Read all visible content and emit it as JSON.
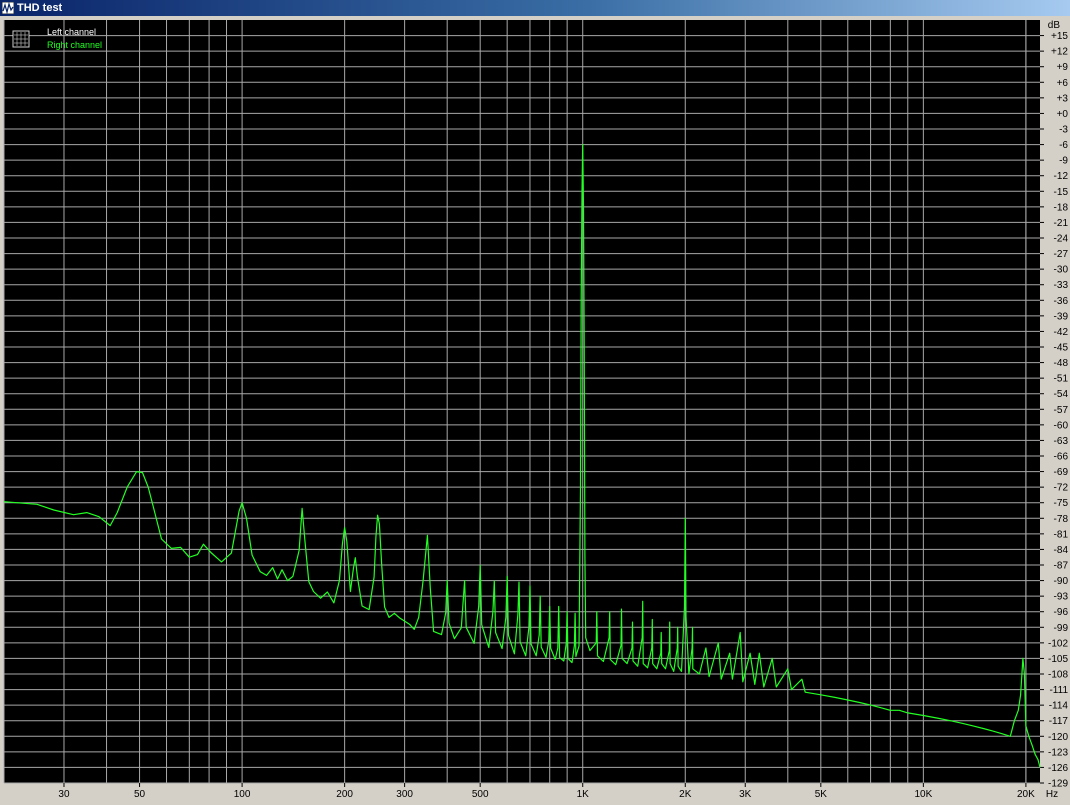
{
  "window": {
    "title": "THD test"
  },
  "colors": {
    "plot_bg": "#000000",
    "grid": "#a8a8a8",
    "panel": "#d4d0c8",
    "left_channel": "#ffffff",
    "right_channel": "#22ff22"
  },
  "chart_data": {
    "type": "line",
    "title": "THD test",
    "xlabel": "Hz",
    "ylabel": "dB",
    "x_scale": "log",
    "xlim": [
      20,
      22000
    ],
    "ylim": [
      -129,
      18
    ],
    "grid": true,
    "legend_position": "top-left",
    "legend": [
      {
        "name": "Left channel",
        "color": "#ffffff"
      },
      {
        "name": "Right channel",
        "color": "#22ff22"
      }
    ],
    "x_ticks": [
      {
        "value": 30,
        "label": "30"
      },
      {
        "value": 50,
        "label": "50"
      },
      {
        "value": 100,
        "label": "100"
      },
      {
        "value": 200,
        "label": "200"
      },
      {
        "value": 300,
        "label": "300"
      },
      {
        "value": 500,
        "label": "500"
      },
      {
        "value": 1000,
        "label": "1K"
      },
      {
        "value": 2000,
        "label": "2K"
      },
      {
        "value": 3000,
        "label": "3K"
      },
      {
        "value": 5000,
        "label": "5K"
      },
      {
        "value": 10000,
        "label": "10K"
      },
      {
        "value": 20000,
        "label": "20K"
      }
    ],
    "y_ticks": [
      "+15",
      "+12",
      "+9",
      "+6",
      "+3",
      "+0",
      "-3",
      "-6",
      "-9",
      "-12",
      "-15",
      "-18",
      "-21",
      "-24",
      "-27",
      "-30",
      "-33",
      "-36",
      "-39",
      "-42",
      "-45",
      "-48",
      "-51",
      "-54",
      "-57",
      "-60",
      "-63",
      "-66",
      "-69",
      "-72",
      "-75",
      "-78",
      "-81",
      "-84",
      "-87",
      "-90",
      "-93",
      "-96",
      "-99",
      "-102",
      "-105",
      "-108",
      "-111",
      "-114",
      "-117",
      "-120",
      "-123",
      "-126",
      "-129"
    ],
    "series": [
      {
        "name": "Right channel",
        "color": "#22ff22",
        "points": [
          [
            20,
            -74.8
          ],
          [
            25,
            -75.3
          ],
          [
            28,
            -76.4
          ],
          [
            32,
            -77.3
          ],
          [
            35,
            -76.9
          ],
          [
            38,
            -77.7
          ],
          [
            41,
            -79.4
          ],
          [
            43,
            -76.9
          ],
          [
            46,
            -72.0
          ],
          [
            49,
            -69.0
          ],
          [
            51,
            -69.2
          ],
          [
            53,
            -72.0
          ],
          [
            55,
            -76.1
          ],
          [
            58,
            -82.0
          ],
          [
            62,
            -83.8
          ],
          [
            66,
            -83.6
          ],
          [
            70,
            -85.5
          ],
          [
            74,
            -85.0
          ],
          [
            77,
            -83.0
          ],
          [
            81,
            -84.6
          ],
          [
            87,
            -86.4
          ],
          [
            93,
            -84.7
          ],
          [
            98,
            -76.6
          ],
          [
            100,
            -75.0
          ],
          [
            103,
            -78.0
          ],
          [
            107,
            -85.1
          ],
          [
            113,
            -88.3
          ],
          [
            118,
            -89.0
          ],
          [
            123,
            -87.5
          ],
          [
            127,
            -89.7
          ],
          [
            131,
            -87.9
          ],
          [
            136,
            -90.0
          ],
          [
            141,
            -89.2
          ],
          [
            147,
            -84.2
          ],
          [
            150,
            -76.1
          ],
          [
            153,
            -82.5
          ],
          [
            157,
            -90.2
          ],
          [
            162,
            -92.1
          ],
          [
            170,
            -93.4
          ],
          [
            178,
            -92.2
          ],
          [
            186,
            -94.3
          ],
          [
            193,
            -90.0
          ],
          [
            197,
            -83.0
          ],
          [
            200,
            -79.8
          ],
          [
            203,
            -82.4
          ],
          [
            208,
            -92.1
          ],
          [
            212,
            -87.8
          ],
          [
            215,
            -85.6
          ],
          [
            218,
            -89.3
          ],
          [
            225,
            -94.9
          ],
          [
            236,
            -95.6
          ],
          [
            244,
            -89.3
          ],
          [
            247,
            -81.6
          ],
          [
            250,
            -77.4
          ],
          [
            253,
            -79.1
          ],
          [
            257,
            -87.0
          ],
          [
            262,
            -95.1
          ],
          [
            270,
            -97.1
          ],
          [
            280,
            -96.3
          ],
          [
            290,
            -97.2
          ],
          [
            300,
            -97.8
          ],
          [
            310,
            -98.4
          ],
          [
            320,
            -99.4
          ],
          [
            330,
            -97.1
          ],
          [
            340,
            -90.0
          ],
          [
            350,
            -81.3
          ],
          [
            357,
            -91.5
          ],
          [
            365,
            -99.8
          ],
          [
            385,
            -100.4
          ],
          [
            396,
            -96.2
          ],
          [
            400,
            -90.0
          ],
          [
            405,
            -98.2
          ],
          [
            420,
            -101.2
          ],
          [
            440,
            -99.1
          ],
          [
            450,
            -90.0
          ],
          [
            455,
            -99.0
          ],
          [
            480,
            -102.1
          ],
          [
            495,
            -95.0
          ],
          [
            500,
            -87.1
          ],
          [
            505,
            -98.5
          ],
          [
            530,
            -102.9
          ],
          [
            545,
            -96.0
          ],
          [
            550,
            -90.1
          ],
          [
            555,
            -100.0
          ],
          [
            580,
            -103.1
          ],
          [
            595,
            -97.0
          ],
          [
            600,
            -89.2
          ],
          [
            605,
            -100.5
          ],
          [
            630,
            -104.1
          ],
          [
            645,
            -96.5
          ],
          [
            650,
            -90.3
          ],
          [
            655,
            -101.8
          ],
          [
            680,
            -104.5
          ],
          [
            695,
            -99.0
          ],
          [
            700,
            -91.0
          ],
          [
            705,
            -102.2
          ],
          [
            730,
            -104.5
          ],
          [
            745,
            -100.5
          ],
          [
            750,
            -93.0
          ],
          [
            755,
            -102.8
          ],
          [
            780,
            -104.8
          ],
          [
            795,
            -101.5
          ],
          [
            800,
            -95.0
          ],
          [
            805,
            -103.0
          ],
          [
            830,
            -105.2
          ],
          [
            845,
            -103.0
          ],
          [
            850,
            -95.0
          ],
          [
            855,
            -104.8
          ],
          [
            880,
            -105.5
          ],
          [
            895,
            -102.0
          ],
          [
            900,
            -96.0
          ],
          [
            905,
            -105.0
          ],
          [
            930,
            -105.8
          ],
          [
            945,
            -102.5
          ],
          [
            950,
            -96.3
          ],
          [
            955,
            -104.6
          ],
          [
            975,
            -102.6
          ],
          [
            985,
            -72.0
          ],
          [
            990,
            -35.0
          ],
          [
            995,
            -15.0
          ],
          [
            1000,
            -6.0
          ],
          [
            1005,
            -18.0
          ],
          [
            1010,
            -45.0
          ],
          [
            1015,
            -85.0
          ],
          [
            1020,
            -101.0
          ],
          [
            1050,
            -103.5
          ],
          [
            1095,
            -102.0
          ],
          [
            1100,
            -96.0
          ],
          [
            1105,
            -104.5
          ],
          [
            1150,
            -105.6
          ],
          [
            1195,
            -101.0
          ],
          [
            1200,
            -96.0
          ],
          [
            1205,
            -105.2
          ],
          [
            1250,
            -106.2
          ],
          [
            1295,
            -102.5
          ],
          [
            1300,
            -95.5
          ],
          [
            1305,
            -105.0
          ],
          [
            1350,
            -106.0
          ],
          [
            1395,
            -103.0
          ],
          [
            1400,
            -98.0
          ],
          [
            1405,
            -105.5
          ],
          [
            1450,
            -106.5
          ],
          [
            1495,
            -101.0
          ],
          [
            1500,
            -94.0
          ],
          [
            1505,
            -106.0
          ],
          [
            1550,
            -106.8
          ],
          [
            1595,
            -103.0
          ],
          [
            1600,
            -97.5
          ],
          [
            1605,
            -106.0
          ],
          [
            1650,
            -107.0
          ],
          [
            1695,
            -104.0
          ],
          [
            1700,
            -100.0
          ],
          [
            1705,
            -106.0
          ],
          [
            1750,
            -107.0
          ],
          [
            1795,
            -103.5
          ],
          [
            1800,
            -98.0
          ],
          [
            1805,
            -106.0
          ],
          [
            1850,
            -107.5
          ],
          [
            1895,
            -103.0
          ],
          [
            1900,
            -99.0
          ],
          [
            1905,
            -106.5
          ],
          [
            1950,
            -107.5
          ],
          [
            1990,
            -95.0
          ],
          [
            2000,
            -78.0
          ],
          [
            2010,
            -97.0
          ],
          [
            2050,
            -108.0
          ],
          [
            2095,
            -103.0
          ],
          [
            2100,
            -99.0
          ],
          [
            2105,
            -107.0
          ],
          [
            2200,
            -108.0
          ],
          [
            2300,
            -103.0
          ],
          [
            2350,
            -108.5
          ],
          [
            2500,
            -102.0
          ],
          [
            2550,
            -109.0
          ],
          [
            2700,
            -104.0
          ],
          [
            2750,
            -109.0
          ],
          [
            2900,
            -100.0
          ],
          [
            2950,
            -109.5
          ],
          [
            3100,
            -104.0
          ],
          [
            3200,
            -110.0
          ],
          [
            3300,
            -104.0
          ],
          [
            3400,
            -110.5
          ],
          [
            3600,
            -105.0
          ],
          [
            3700,
            -110.5
          ],
          [
            4000,
            -107.0
          ],
          [
            4100,
            -111.0
          ],
          [
            4400,
            -109.0
          ],
          [
            4500,
            -111.5
          ],
          [
            5000,
            -112.0
          ],
          [
            5500,
            -112.5
          ],
          [
            6000,
            -113.0
          ],
          [
            6500,
            -113.5
          ],
          [
            7000,
            -114.0
          ],
          [
            7500,
            -114.5
          ],
          [
            8000,
            -115.0
          ],
          [
            8500,
            -115.0
          ],
          [
            9000,
            -115.5
          ],
          [
            10000,
            -116.0
          ],
          [
            11000,
            -116.5
          ],
          [
            12000,
            -117.0
          ],
          [
            13000,
            -117.5
          ],
          [
            14000,
            -118.0
          ],
          [
            15000,
            -118.5
          ],
          [
            16000,
            -119.0
          ],
          [
            17000,
            -119.5
          ],
          [
            18000,
            -120.0
          ],
          [
            18500,
            -117.0
          ],
          [
            19000,
            -115.0
          ],
          [
            19300,
            -112.0
          ],
          [
            19600,
            -105.0
          ],
          [
            19800,
            -108.0
          ],
          [
            20000,
            -118.0
          ],
          [
            20400,
            -120.0
          ],
          [
            20800,
            -121.5
          ],
          [
            21300,
            -123.5
          ],
          [
            21700,
            -124.5
          ],
          [
            22000,
            -126.0
          ]
        ]
      }
    ]
  }
}
